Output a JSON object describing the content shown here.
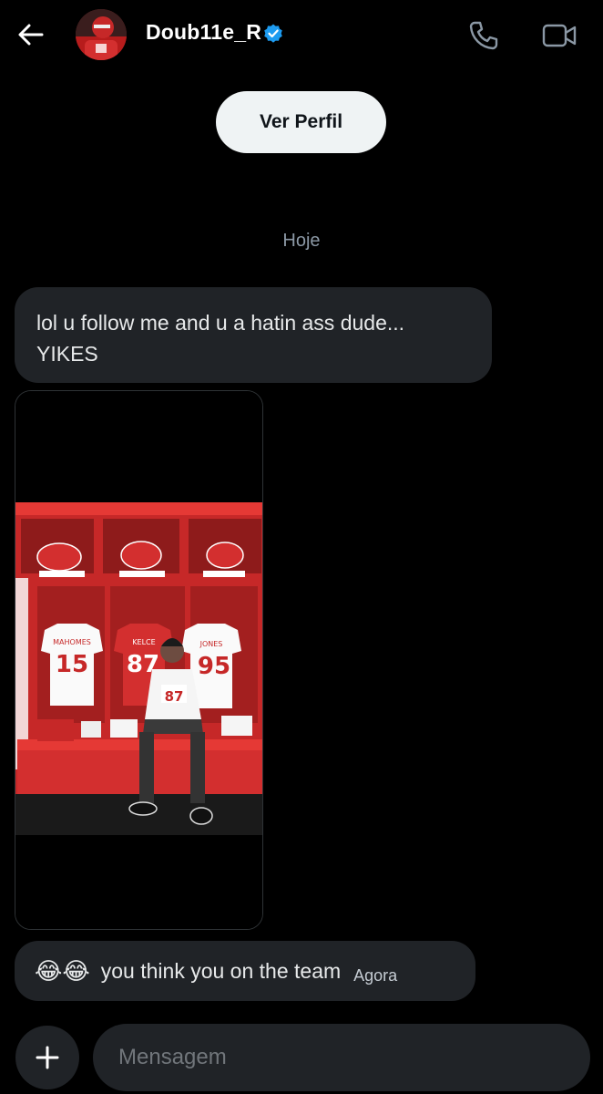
{
  "header": {
    "username": "Doub11e_R",
    "verified_color": "#1d9bf0",
    "icons": [
      "back-arrow-icon",
      "verified-badge-icon",
      "phone-icon",
      "video-icon"
    ]
  },
  "profile_button": {
    "label": "Ver Perfil"
  },
  "day_separator": "Hoje",
  "messages": [
    {
      "text": "lol u follow me and u a hatin ass dude... YIKES"
    },
    {
      "type": "image",
      "jerseys": [
        "MAHOMES 15",
        "KELCE 87",
        "JONES 95"
      ]
    },
    {
      "emoji": "😂😂",
      "text": "you think you on the team",
      "time": "Agora"
    }
  ],
  "composer": {
    "placeholder": "Mensagem",
    "add_icon": "plus-icon"
  },
  "colors": {
    "background": "#000000",
    "bubble": "#202327",
    "accent": "#1d9bf0"
  }
}
